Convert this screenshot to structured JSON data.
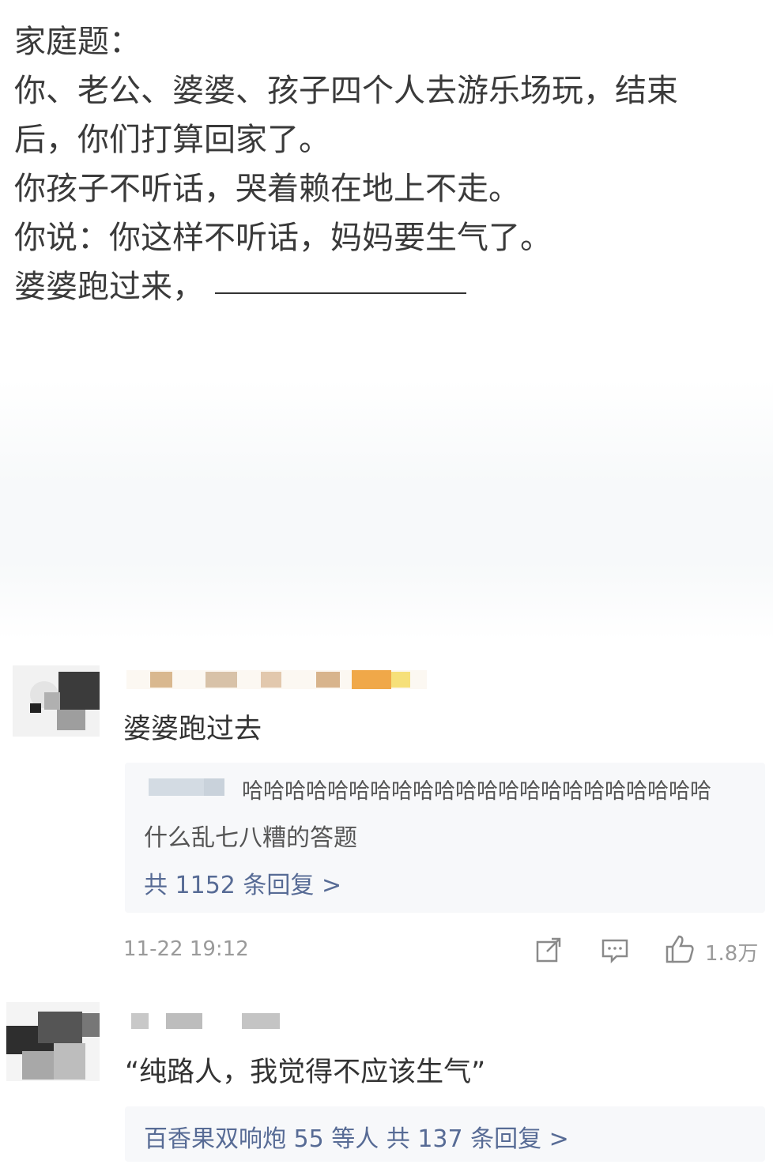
{
  "post": {
    "lines": [
      "家庭题：",
      "你、老公、婆婆、孩子四个人去游乐场玩，结束",
      "后，你们打算回家了。",
      "你孩子不听话，哭着赖在地上不走。",
      "你说：你这样不听话，妈妈要生气了。",
      "婆婆跑过来，"
    ]
  },
  "comments": [
    {
      "text": "婆婆跑过去",
      "reply": {
        "text_line1": "哈哈哈哈哈哈哈哈哈哈哈哈哈哈哈哈哈哈哈哈哈哈",
        "text_line2": "什么乱七八糟的答题",
        "more_replies": "共 1152 条回复 >"
      },
      "timestamp": "11-22 19:12",
      "likes": "1.8万",
      "icons": [
        "share-icon",
        "comment-icon",
        "like-icon"
      ]
    },
    {
      "text": "“纯路人，我觉得不应该生气”",
      "reply_summary": "百香果双响炮 55 等人  共 137 条回复 >"
    }
  ],
  "colors": {
    "text": "#333333",
    "meta": "#9a9a9a",
    "link": "#576b95",
    "reply_bg": "#f7f8fa"
  }
}
